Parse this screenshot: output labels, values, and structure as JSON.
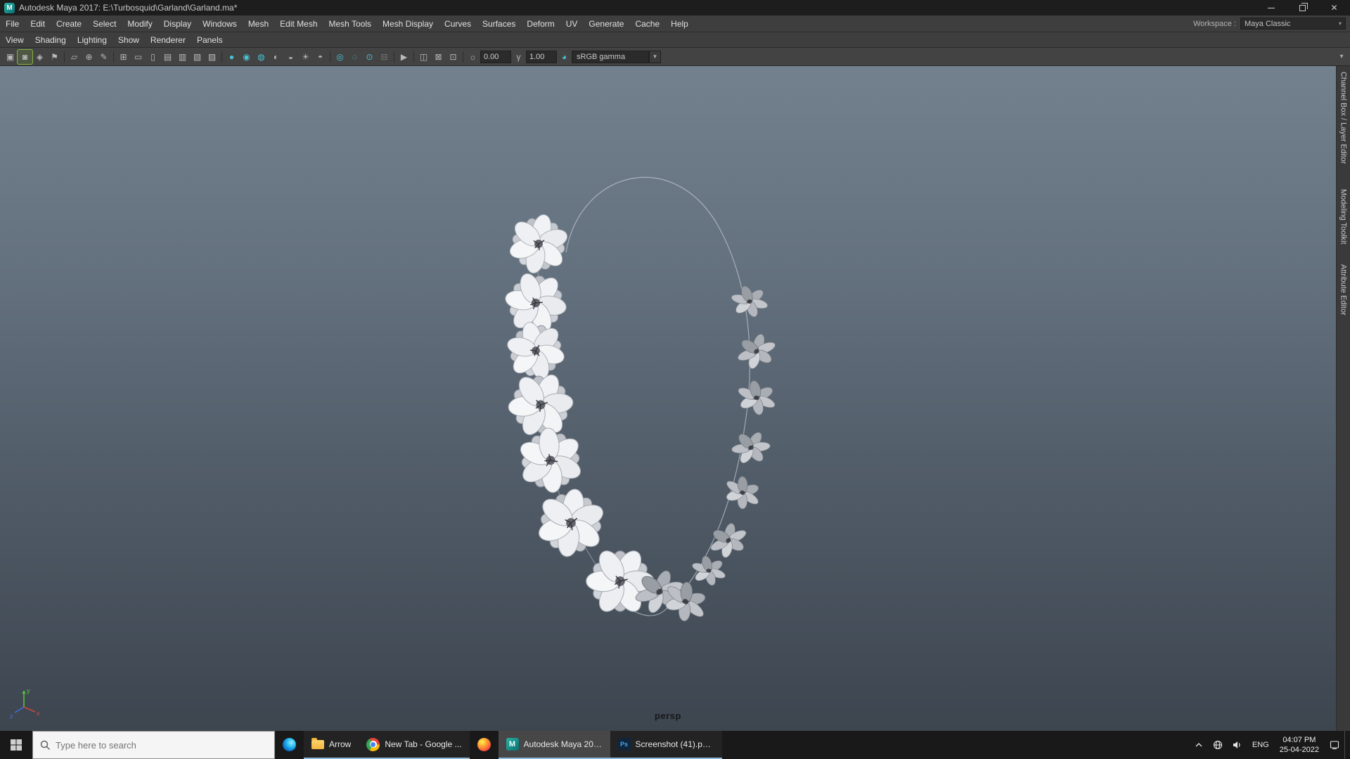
{
  "window": {
    "title": "Autodesk Maya 2017: E:\\Turbosquid\\Garland\\Garland.ma*"
  },
  "menu_bar": {
    "items": [
      "File",
      "Edit",
      "Create",
      "Select",
      "Modify",
      "Display",
      "Windows",
      "Mesh",
      "Edit Mesh",
      "Mesh Tools",
      "Mesh Display",
      "Curves",
      "Surfaces",
      "Deform",
      "UV",
      "Generate",
      "Cache",
      "Help"
    ],
    "workspace_label": "Workspace :",
    "workspace_value": "Maya Classic"
  },
  "panel_menu": {
    "items": [
      "View",
      "Shading",
      "Lighting",
      "Show",
      "Renderer",
      "Panels"
    ]
  },
  "toolbar": {
    "exposure_value": "0.00",
    "gamma_value": "1.00",
    "view_transform": "sRGB gamma"
  },
  "viewport": {
    "camera_label": "persp",
    "axis": {
      "x": "x",
      "y": "y",
      "z": "z"
    }
  },
  "side_tabs": {
    "channel_box": "Channel Box / Layer Editor",
    "modeling_toolkit": "Modeling Toolkit",
    "attribute_editor": "Attribute Editor"
  },
  "taskbar": {
    "search_placeholder": "Type here to search",
    "buttons": {
      "explorer": "Arrow",
      "chrome": "New Tab - Google ...",
      "maya": "Autodesk Maya 201...",
      "photoshop": "Screenshot (41).pn..."
    },
    "tray": {
      "language": "ENG",
      "time": "04:07 PM",
      "date": "25-04-2022"
    }
  },
  "icons": {
    "maya_logo": "M",
    "ps_logo": "Ps",
    "close": "✕",
    "select_camera": "▣",
    "camera_selected": "◙",
    "camera_attributes": "◈",
    "bookmark": "⚑",
    "image_plane": "▱",
    "pan_zoom": "⊕",
    "grease_pencil": "✎",
    "grid": "⊞",
    "film_gate": "▭",
    "resolution_gate": "▯",
    "gate_mask": "▤",
    "field_chart": "▥",
    "safe_action": "▧",
    "safe_title": "▨",
    "shaded": "●",
    "smooth_shade": "◉",
    "wireframe_on_shaded": "◍",
    "textured": "◐",
    "default_material": "◒",
    "lights": "☀",
    "shadows": "◓",
    "ssao": "◎",
    "motion_blur": "◌",
    "multisample": "⊙",
    "sequence_time": "⊟",
    "isolate_select": "▶",
    "xray": "◫",
    "xray_joints": "⊠",
    "xray_active": "⊡",
    "exposure": "☼",
    "gamma": "γ",
    "view_transform_toggle": "◕",
    "dropdown_arrow": "▼",
    "overflow_arrow": "▾",
    "workspace_arrow": "▾"
  }
}
